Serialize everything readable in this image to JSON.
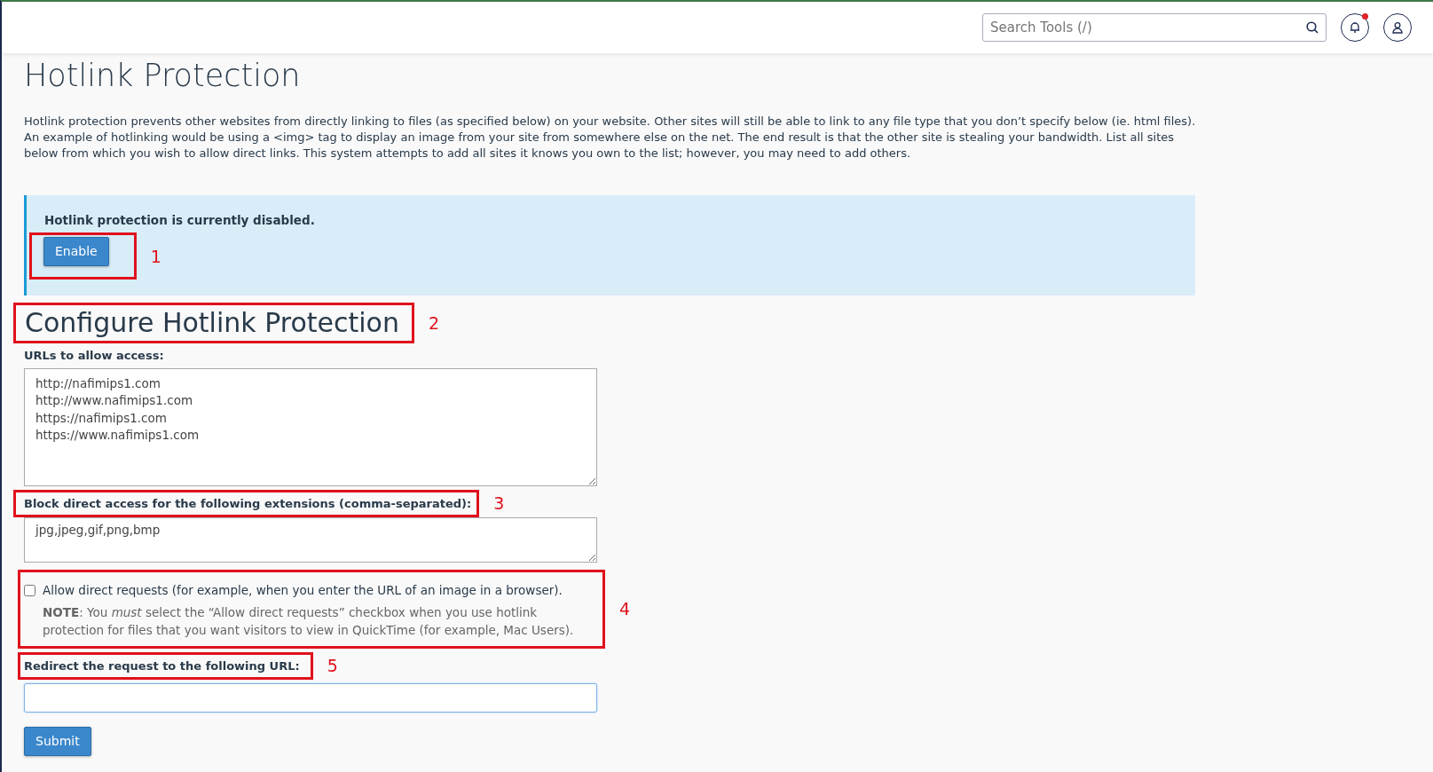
{
  "header": {
    "search": {
      "placeholder": "Search Tools (/)"
    },
    "notifications": {
      "unread": true
    }
  },
  "page_title": "Hotlink Protection",
  "description": "Hotlink protection prevents other websites from directly linking to files (as specified below) on your website. Other sites will still be able to link to any file type that you don’t specify below (ie. html files). An example of hotlinking would be using a <img> tag to display an image from your site from somewhere else on the net. The end result is that the other site is stealing your bandwidth. List all sites below from which you wish to allow direct links. This system attempts to add all sites it knows you own to the list; however, you may need to add others.",
  "status_alert": {
    "message": "Hotlink protection is currently disabled.",
    "button": "Enable",
    "annotation": "1"
  },
  "configure": {
    "heading": "Configure Hotlink Protection",
    "annotation": "2",
    "urls_label": "URLs to allow access:",
    "urls": [
      "http://nafimips1.com",
      "http://www.nafimips1.com",
      "https://nafimips1.com",
      "https://www.nafimips1.com"
    ],
    "extensions_label": "Block direct access for the following extensions (comma-separated):",
    "extensions_annotation": "3",
    "extensions": "jpg,jpeg,gif,png,bmp",
    "allow_direct": {
      "label": "Allow direct requests (for example, when you enter the URL of an image in a browser).",
      "checked": false,
      "note": "**NOTE**: You *must* select the “Allow direct requests” checkbox when you use hotlink protection for files that you want visitors to view in QuickTime (for example, Mac Users).",
      "annotation": "4"
    },
    "redirect_label": "Redirect the request to the following URL:",
    "redirect_annotation": "5",
    "submit": "Submit"
  }
}
